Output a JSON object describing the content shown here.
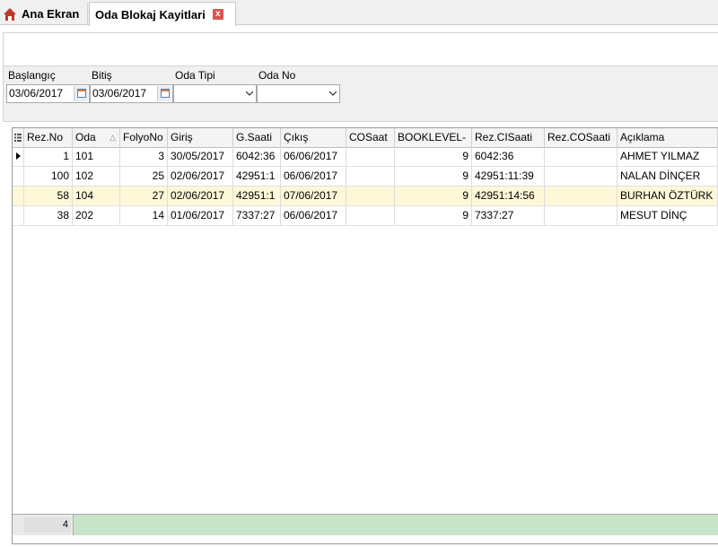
{
  "tabs": {
    "home": "Ana Ekran",
    "active": "Oda Blokaj Kayitlari",
    "close_glyph": "x"
  },
  "filters": {
    "start_label": "Başlangıç",
    "start_value": "03/06/2017",
    "end_label": "Bitiş",
    "end_value": "03/06/2017",
    "room_type_label": "Oda Tipi",
    "room_type_value": "",
    "room_no_label": "Oda No",
    "room_no_value": ""
  },
  "grid": {
    "columns": [
      "Rez.No",
      "Oda",
      "FolyoNo",
      "Giriş",
      "G.Saati",
      "Çıkış",
      "COSaat",
      "BOOKLEVEL-",
      "Rez.CISaati",
      "Rez.COSaati",
      "Açıklama"
    ],
    "sort_indicator": "△",
    "rows": [
      [
        "1",
        "101",
        "3",
        "30/05/2017",
        "6042:36",
        "06/06/2017",
        "",
        "9",
        "6042:36",
        "",
        "AHMET YILMAZ"
      ],
      [
        "100",
        "102",
        "25",
        "02/06/2017",
        "42951:1",
        "06/06/2017",
        "",
        "9",
        "42951:11:39",
        "",
        "NALAN DİNÇER"
      ],
      [
        "58",
        "104",
        "27",
        "02/06/2017",
        "42951:1",
        "07/06/2017",
        "",
        "9",
        "42951:14:56",
        "",
        "BURHAN ÖZTÜRK"
      ],
      [
        "38",
        "202",
        "14",
        "01/06/2017",
        "7337:27",
        "06/06/2017",
        "",
        "9",
        "7337:27",
        "",
        "MESUT DİNÇ"
      ]
    ],
    "record_count": "4"
  },
  "colors": {
    "selected_row": "#fff8d8",
    "footer_green": "#c8e4c8",
    "tab_close": "#d9534f"
  }
}
